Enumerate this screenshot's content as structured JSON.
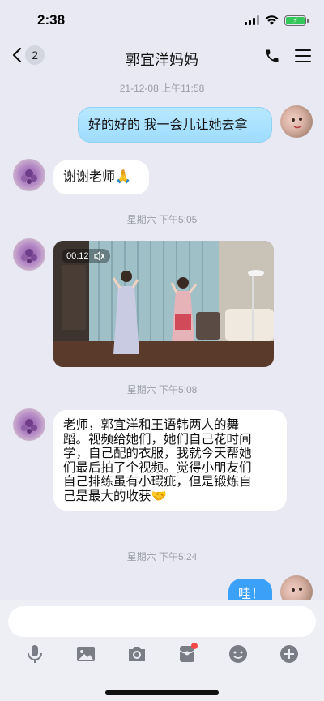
{
  "status": {
    "time": "2:38",
    "battery_color": "#34c759"
  },
  "nav": {
    "unread_count": "2",
    "title": "郭宜洋妈妈",
    "icons": [
      "back-chevron-icon",
      "phone-icon",
      "menu-icon"
    ]
  },
  "chat": {
    "messages": [
      {
        "type": "timestamp",
        "text": "21-12-08 上午11:58"
      },
      {
        "type": "text",
        "side": "right",
        "text": "好的好的 我一会儿让她去拿"
      },
      {
        "type": "text",
        "side": "left",
        "text": "谢谢老师🙏"
      },
      {
        "type": "timestamp",
        "text": "星期六 下午5:05"
      },
      {
        "type": "video",
        "side": "left",
        "duration": "00:12",
        "muted": true
      },
      {
        "type": "timestamp",
        "text": "星期六 下午5:08"
      },
      {
        "type": "text",
        "side": "left",
        "lines": [
          "老师，郭宜洋和王语韩两人的舞",
          "蹈。视频给她们，她们自己花时间",
          "学，自己配的衣服，我就今天帮她",
          "们最后拍了个视频。觉得小朋友们",
          "自己排练虽有小瑕疵，但是锻炼自",
          "己是最大的收获🤝"
        ]
      },
      {
        "type": "timestamp",
        "text": "星期六 下午5:24"
      },
      {
        "type": "text",
        "side": "right",
        "text": "哇！"
      }
    ]
  },
  "input": {
    "placeholder": "",
    "value": ""
  },
  "toolbar": {
    "icons": [
      "microphone-icon",
      "image-icon",
      "camera-icon",
      "red-packet-icon",
      "emoji-icon",
      "plus-icon"
    ],
    "accent": "#f24848"
  }
}
